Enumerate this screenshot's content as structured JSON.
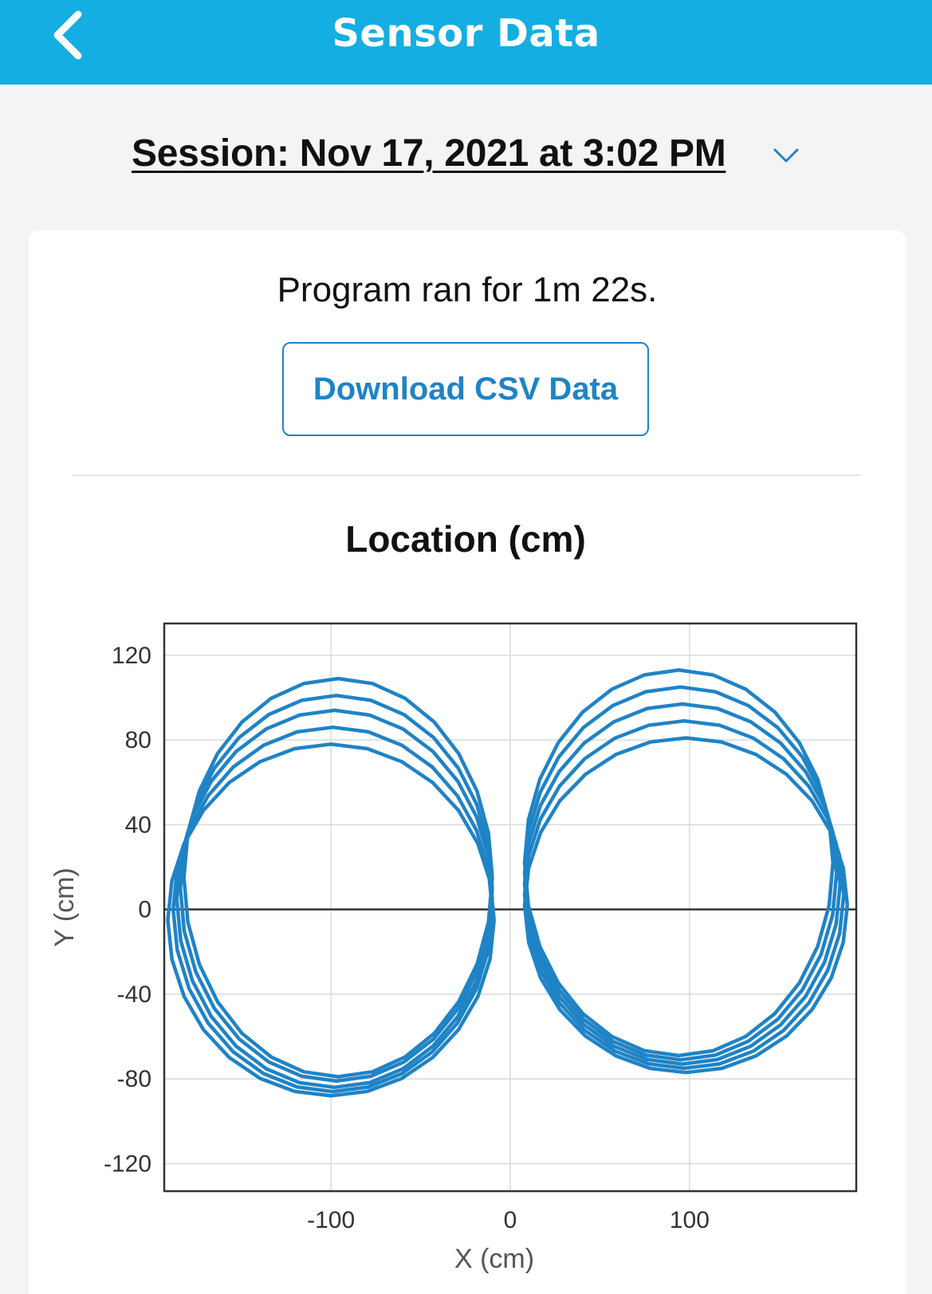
{
  "header": {
    "title": "Sensor Data",
    "back_icon": "chevron-left-icon"
  },
  "session": {
    "label": "Session: Nov 17, 2021 at 3:02 PM",
    "dropdown_icon": "chevron-down-icon"
  },
  "summary": {
    "runtime_text": "Program ran for 1m 22s.",
    "download_label": "Download CSV Data"
  },
  "colors": {
    "header_bg": "#14aee2",
    "accent": "#1f83c6",
    "line": "#1f83c6"
  },
  "chart_data": {
    "type": "line",
    "title": "Location (cm)",
    "xlabel": "X (cm)",
    "ylabel": "Y (cm)",
    "xlim": [
      -193,
      193
    ],
    "ylim": [
      -133,
      135
    ],
    "xticks": [
      -100,
      0,
      100
    ],
    "xtick_labels": [
      "-100",
      "0",
      "100"
    ],
    "yticks": [
      120,
      80,
      40,
      0,
      -40,
      -80,
      -120
    ],
    "ytick_labels": [
      "120",
      "80",
      "40",
      "0",
      "-40",
      "-80",
      "-120"
    ],
    "grid": true,
    "legend": "none",
    "series": [
      {
        "loops": [
          {
            "center": [
              -96,
              15
            ],
            "rx": 86,
            "ry": 94
          },
          {
            "center": [
              -97,
              10
            ],
            "rx": 87,
            "ry": 91
          },
          {
            "center": [
              -98,
              5
            ],
            "rx": 88,
            "ry": 89
          },
          {
            "center": [
              -99,
              0
            ],
            "rx": 89,
            "ry": 86
          },
          {
            "center": [
              -100,
              -5
            ],
            "rx": 91,
            "ry": 83
          },
          {
            "center": [
              94,
              22
            ],
            "rx": 86,
            "ry": 91
          },
          {
            "center": [
              95,
              17
            ],
            "rx": 87,
            "ry": 88
          },
          {
            "center": [
              96,
              12
            ],
            "rx": 88,
            "ry": 85
          },
          {
            "center": [
              97,
              7
            ],
            "rx": 89,
            "ry": 82
          },
          {
            "center": [
              98,
              2
            ],
            "rx": 90,
            "ry": 79
          }
        ]
      }
    ]
  }
}
